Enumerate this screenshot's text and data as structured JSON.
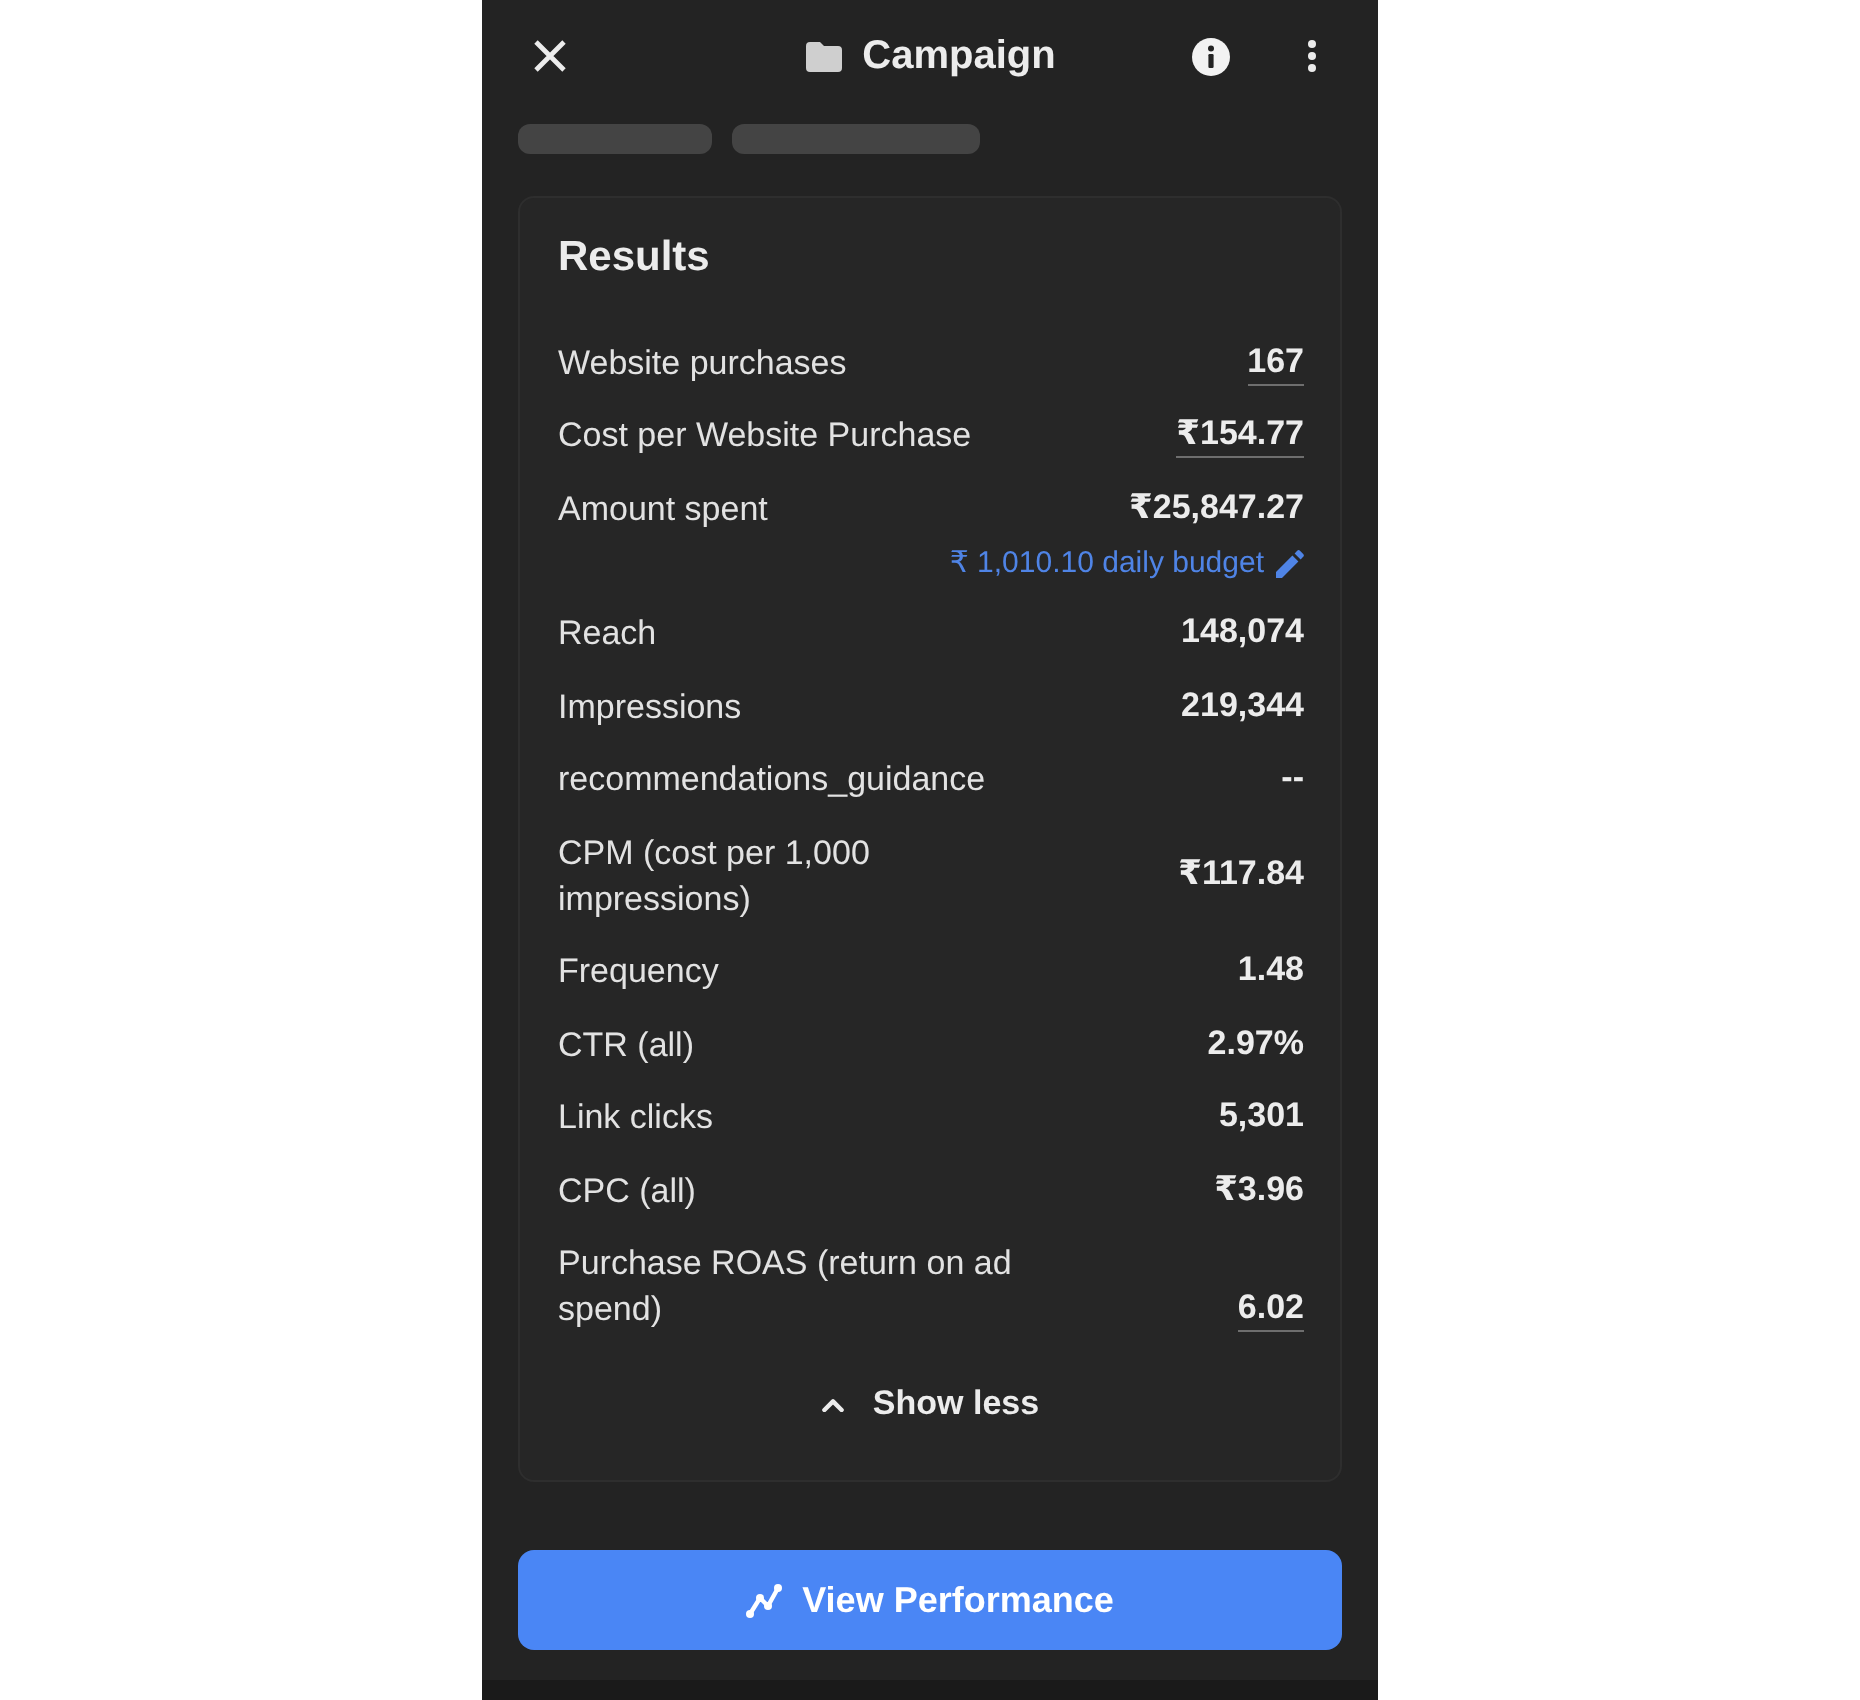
{
  "header": {
    "title": "Campaign"
  },
  "results": {
    "title": "Results",
    "metrics": [
      {
        "label": "Website purchases",
        "value": "167",
        "underlined": true
      },
      {
        "label": "Cost per Website Purchase",
        "value": "₹154.77",
        "underlined": true
      },
      {
        "label": "Amount spent",
        "value": "₹25,847.27",
        "underlined": false,
        "budget": "₹ 1,010.10 daily budget"
      },
      {
        "label": "Reach",
        "value": "148,074",
        "underlined": false
      },
      {
        "label": "Impressions",
        "value": "219,344",
        "underlined": false
      },
      {
        "label": "recommendations_guidance",
        "value": "--",
        "underlined": false
      },
      {
        "label": "CPM (cost per 1,000 impressions)",
        "value": "₹117.84",
        "underlined": false
      },
      {
        "label": "Frequency",
        "value": "1.48",
        "underlined": false
      },
      {
        "label": "CTR (all)",
        "value": "2.97%",
        "underlined": false
      },
      {
        "label": "Link clicks",
        "value": "5,301",
        "underlined": false
      },
      {
        "label": "CPC (all)",
        "value": "₹3.96",
        "underlined": false
      },
      {
        "label": "Purchase ROAS (return on ad spend)",
        "value": "6.02",
        "underlined": true
      }
    ],
    "toggle": {
      "label": "Show less",
      "expanded": true
    }
  },
  "primary_button": {
    "label": "View Performance"
  }
}
